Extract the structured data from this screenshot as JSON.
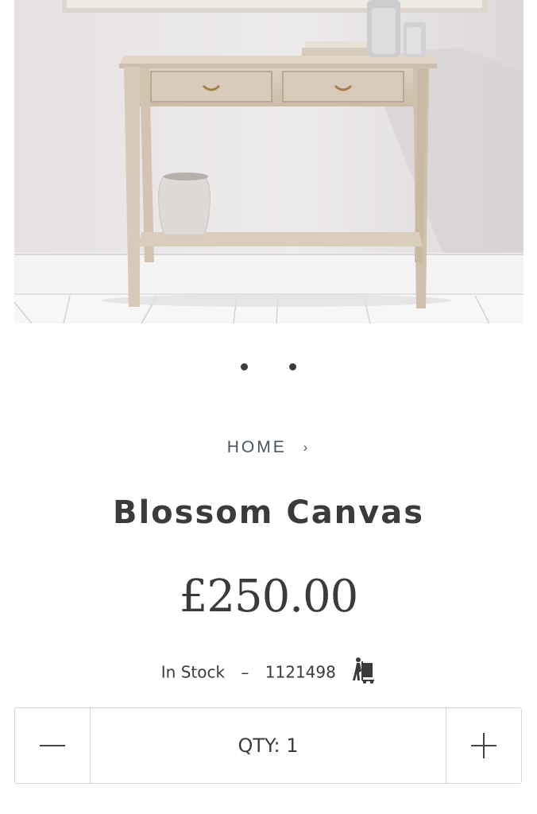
{
  "product_image": {
    "alt": "Console table with two drawers, vases and books against a white wall"
  },
  "carousel": {
    "slides": 2
  },
  "breadcrumb": {
    "home": "HOME",
    "chevron": "›"
  },
  "product": {
    "title": "Blossom Canvas",
    "price": "£250.00",
    "stock_status": "In Stock",
    "separator": "–",
    "sku": "1121498",
    "delivery_icon": "delivery-trolley-icon"
  },
  "quantity": {
    "label": "QTY: 1",
    "decrement_icon": "minus-icon",
    "increment_icon": "plus-icon"
  }
}
